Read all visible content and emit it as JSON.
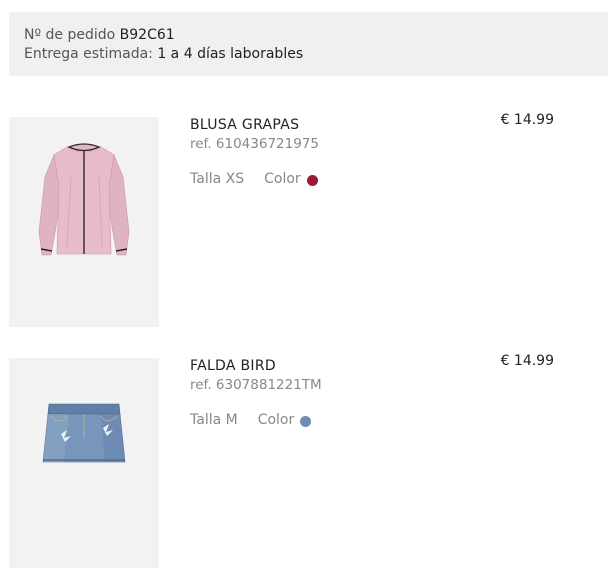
{
  "order": {
    "number_label": "Nº de pedido",
    "number": "B92C61",
    "delivery_label": "Entrega estimada:",
    "delivery_value": "1 a 4 días laborables"
  },
  "items": [
    {
      "name": "BLUSA GRAPAS",
      "ref": "ref. 610436721975",
      "size": "Talla XS",
      "color_label": "Color",
      "color": "#9b1b35",
      "price": "€ 14.99",
      "image_icon": "pink-blouse-image"
    },
    {
      "name": "FALDA BIRD",
      "ref": "ref. 6307881221TM",
      "size": "Talla M",
      "color_label": "Color",
      "color": "#6e8fb0",
      "price": "€ 14.99",
      "image_icon": "denim-skirt-image"
    }
  ]
}
